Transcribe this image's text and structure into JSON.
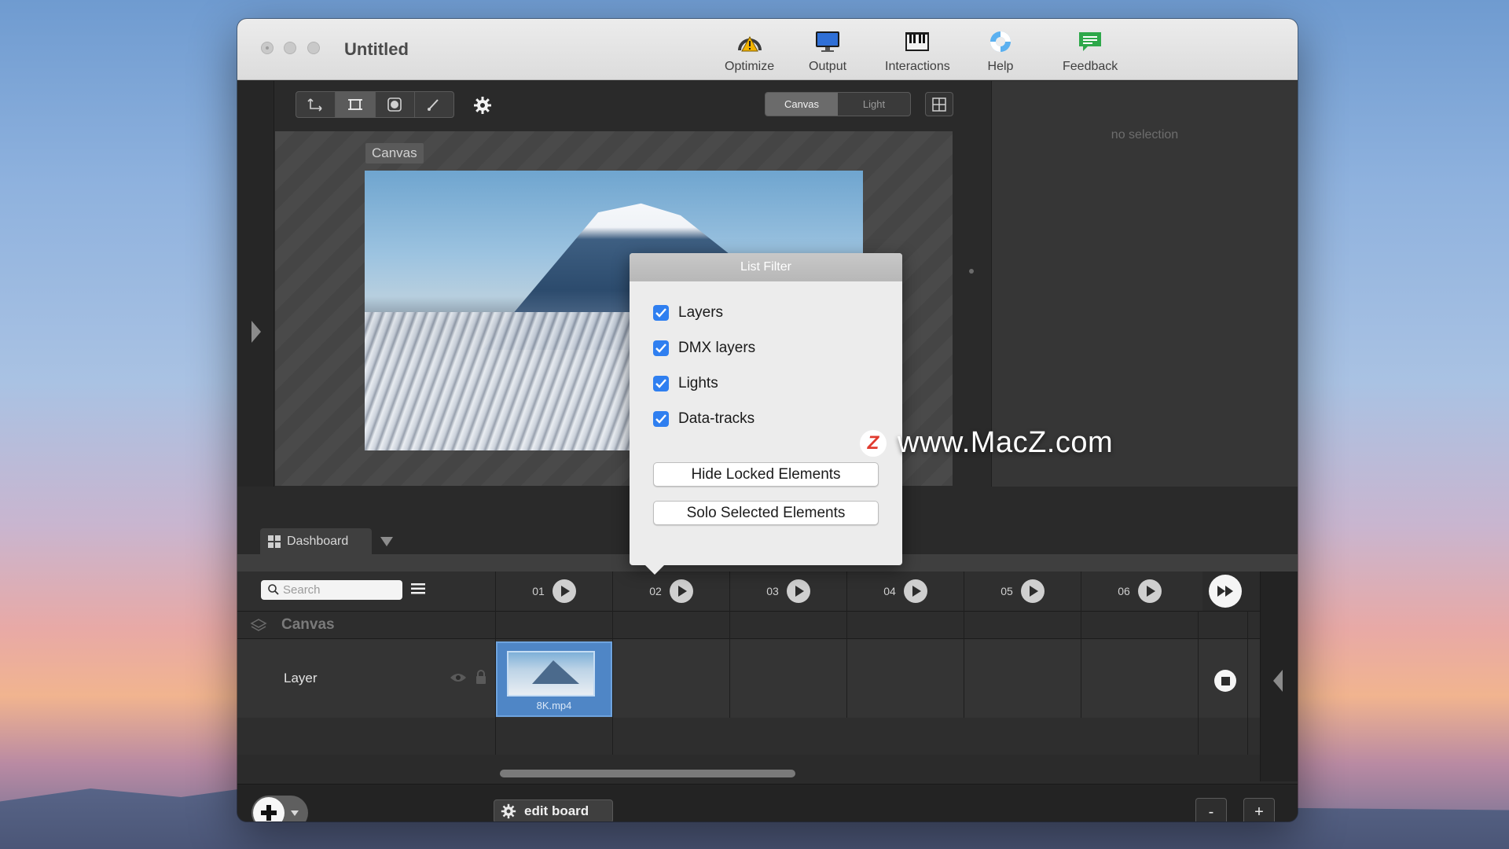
{
  "window": {
    "title": "Untitled"
  },
  "toolbar": {
    "optimize": "Optimize",
    "output": "Output",
    "interactions": "Interactions",
    "help": "Help",
    "feedback": "Feedback"
  },
  "view_toggle": {
    "canvas": "Canvas",
    "light": "Light",
    "selected": "Canvas"
  },
  "canvas": {
    "label": "Canvas"
  },
  "inspector": {
    "empty_text": "no selection"
  },
  "dashboard": {
    "tab_label": "Dashboard"
  },
  "popover": {
    "title": "List Filter",
    "checks": [
      {
        "label": "Layers",
        "checked": true
      },
      {
        "label": "DMX layers",
        "checked": true
      },
      {
        "label": "Lights",
        "checked": true
      },
      {
        "label": "Data-tracks",
        "checked": true
      }
    ],
    "hide_locked": "Hide Locked Elements",
    "solo_selected": "Solo Selected Elements"
  },
  "search": {
    "placeholder": "Search"
  },
  "cues": [
    "01",
    "02",
    "03",
    "04",
    "05",
    "06"
  ],
  "tree": {
    "canvas_row": "Canvas",
    "layer_name": "Layer",
    "clip_name": "8K.mp4"
  },
  "bottom": {
    "edit_board": "edit board",
    "minus": "-",
    "plus": "+"
  },
  "watermark": {
    "logo": "Z",
    "text": "www.MacZ.com"
  },
  "colors": {
    "checkbox": "#2f7ff0",
    "clip": "#4f86c6",
    "window_bg": "#2a2a2a"
  },
  "icons": [
    "optimize-icon",
    "output-monitor-icon",
    "interactions-icon",
    "help-lifebuoy-icon",
    "feedback-icon",
    "gear-icon",
    "search-icon",
    "list-filter-icon",
    "eye-icon",
    "lock-icon",
    "play-icon",
    "fast-forward-icon",
    "stop-icon",
    "plus-icon"
  ]
}
